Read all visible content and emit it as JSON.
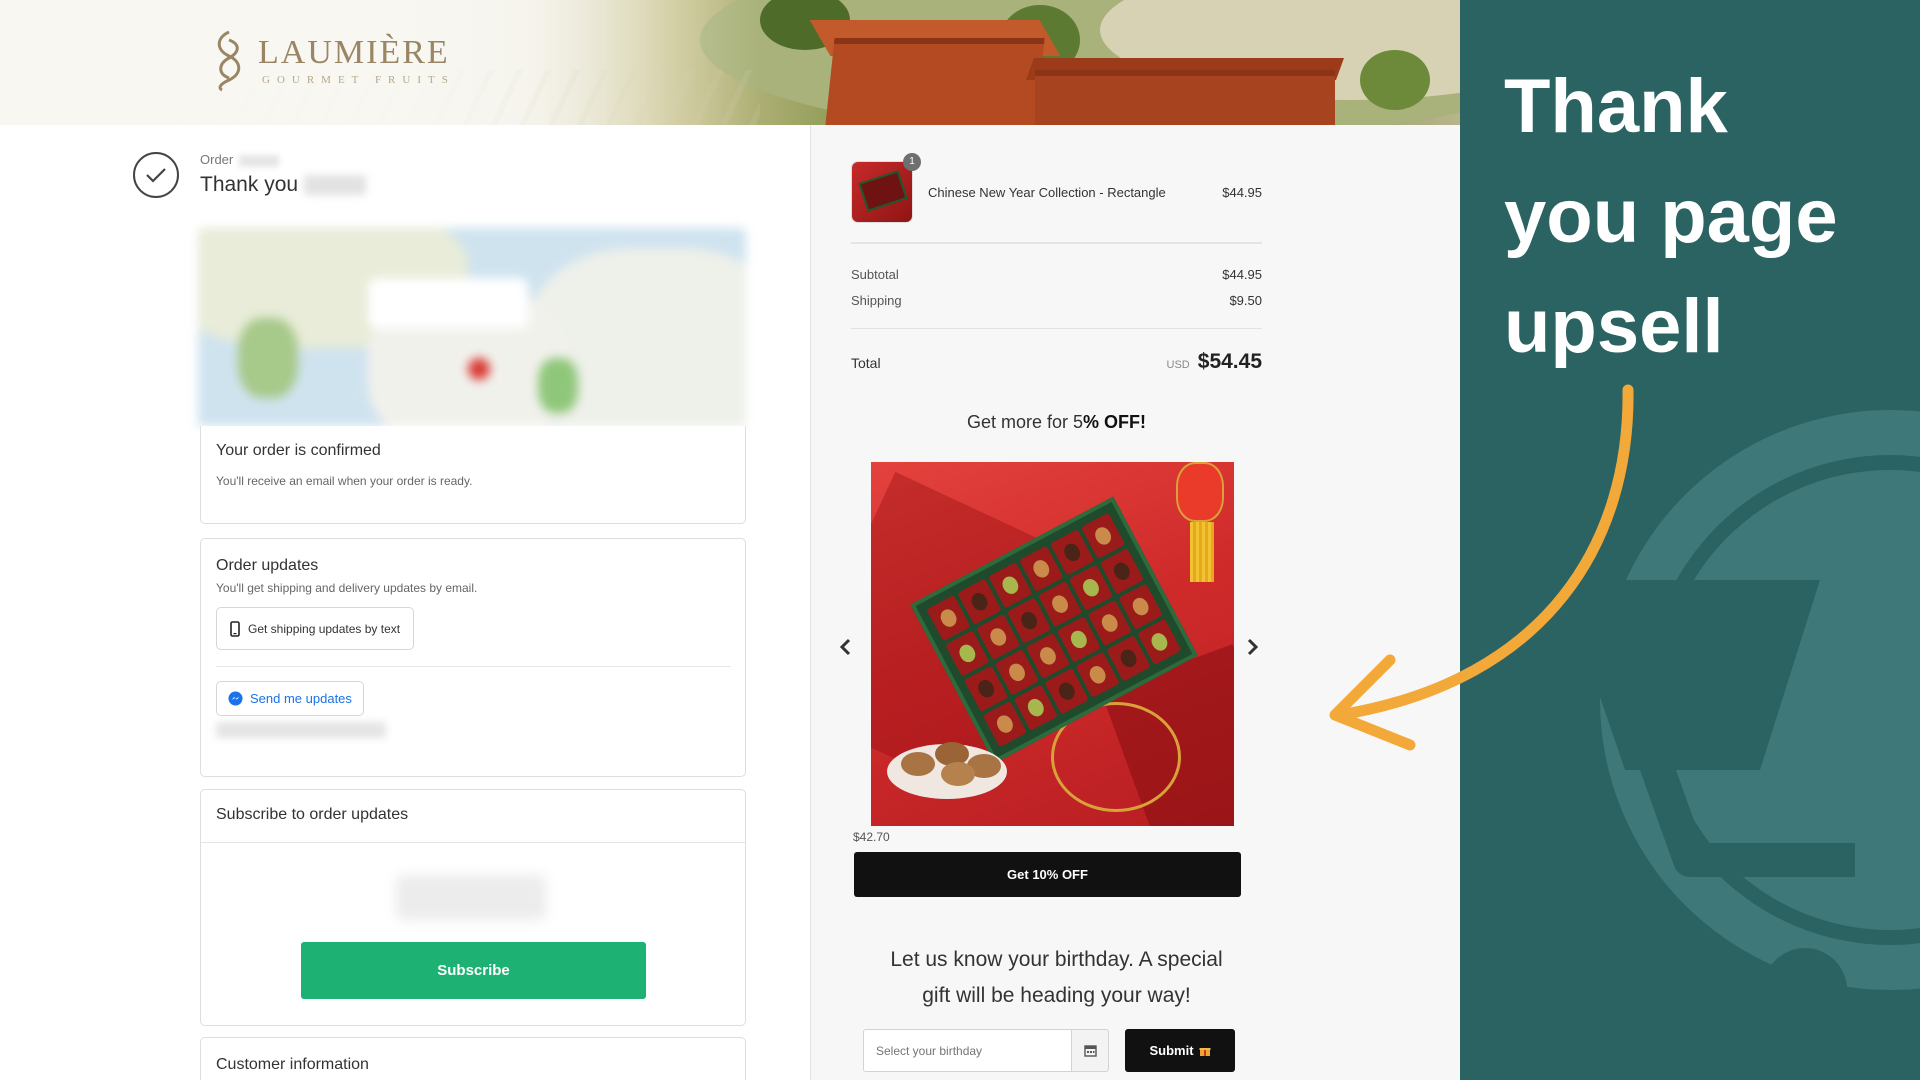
{
  "header": {
    "brand": "LAUMIÈRE",
    "tagline": "GOURMET FRUITS"
  },
  "order": {
    "label": "Order",
    "thank_you": "Thank you"
  },
  "confirmed_card": {
    "title": "Your order is confirmed",
    "subtitle": "You'll receive an email when your order is ready."
  },
  "updates_card": {
    "title": "Order updates",
    "subtitle": "You'll get shipping and delivery updates by email.",
    "text_button": "Get shipping updates by text",
    "messenger_button": "Send me updates"
  },
  "subscribe_card": {
    "title": "Subscribe to order updates",
    "button": "Subscribe"
  },
  "customer_card": {
    "title": "Customer information"
  },
  "summary": {
    "product_name": "Chinese New Year Collection - Rectangle",
    "product_price": "$44.95",
    "quantity": "1",
    "subtotal_label": "Subtotal",
    "subtotal_value": "$44.95",
    "shipping_label": "Shipping",
    "shipping_value": "$9.50",
    "total_label": "Total",
    "currency": "USD",
    "total_value": "$54.45"
  },
  "upsell": {
    "headline_prefix": "Get more for 5",
    "headline_bold": "% OFF!",
    "price": "$42.70",
    "button": "Get 10% OFF",
    "prev_icon": "chevron-left-icon",
    "next_icon": "chevron-right-icon"
  },
  "birthday": {
    "line1": "Let us know your birthday. A special",
    "line2": "gift will be heading your way!",
    "placeholder": "Select your birthday",
    "submit": "Submit"
  },
  "promo": {
    "line1": "Thank",
    "line2": "you page",
    "line3": "upsell",
    "background": "#2b6363",
    "arrow_color": "#f3a93a"
  }
}
